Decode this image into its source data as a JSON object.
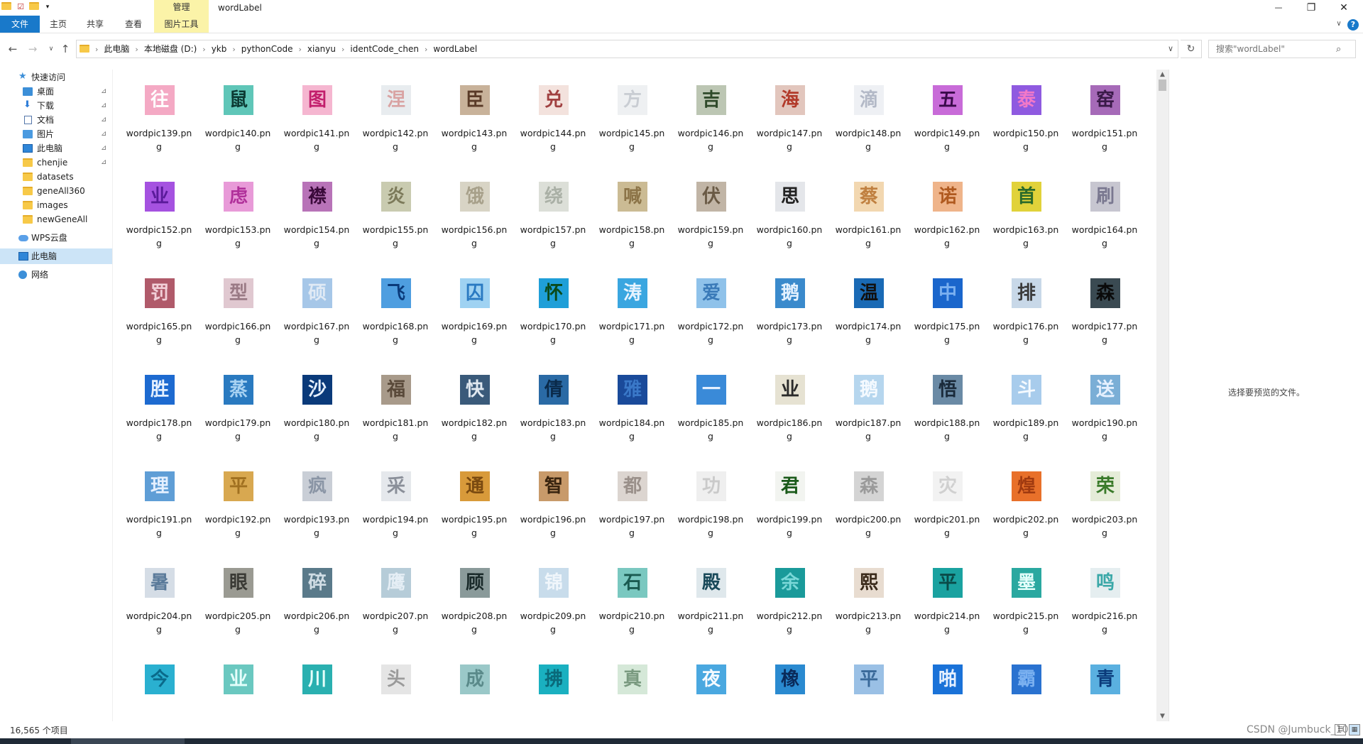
{
  "window": {
    "title": "wordLabel",
    "manage_tab": "管理",
    "min_icon": "—",
    "max_icon": "❐",
    "close_icon": "✕"
  },
  "ribbon": {
    "tabs": [
      "文件",
      "主页",
      "共享",
      "查看",
      "图片工具"
    ],
    "collapse_icon": "∨",
    "help_icon": "?"
  },
  "nav": {
    "back": "←",
    "forward": "→",
    "recent": "∨",
    "up": "↑"
  },
  "address": {
    "crumbs": [
      "此电脑",
      "本地磁盘 (D:)",
      "ykb",
      "pythonCode",
      "xianyu",
      "identCode_chen",
      "wordLabel"
    ],
    "separator": "›",
    "dropdown": "∨",
    "refresh": "↻"
  },
  "search": {
    "placeholder": "搜索\"wordLabel\"",
    "icon": "⌕"
  },
  "sidebar": {
    "items": [
      {
        "label": "快速访问",
        "icon": "star-icon",
        "pinned": false
      },
      {
        "label": "桌面",
        "icon": "desktop-icon",
        "pinned": true
      },
      {
        "label": "下载",
        "icon": "download-icon",
        "pinned": true
      },
      {
        "label": "文档",
        "icon": "document-icon",
        "pinned": true
      },
      {
        "label": "图片",
        "icon": "pictures-icon",
        "pinned": true
      },
      {
        "label": "此电脑",
        "icon": "computer-icon",
        "pinned": true
      },
      {
        "label": "chenjie",
        "icon": "folder-icon",
        "pinned": true
      },
      {
        "label": "datasets",
        "icon": "folder-icon",
        "pinned": false
      },
      {
        "label": "geneAll360",
        "icon": "folder-icon",
        "pinned": false
      },
      {
        "label": "images",
        "icon": "folder-icon",
        "pinned": false
      },
      {
        "label": "newGeneAll",
        "icon": "folder-icon",
        "pinned": false
      },
      {
        "label": "WPS云盘",
        "icon": "cloud-icon",
        "pinned": false
      },
      {
        "label": "此电脑",
        "icon": "computer-icon",
        "pinned": false,
        "selected": true
      },
      {
        "label": "网络",
        "icon": "network-icon",
        "pinned": false
      }
    ],
    "pin_glyph": "📌"
  },
  "files": [
    {
      "name": "wordpic139.png",
      "glyph": "往",
      "bg": "#f4a9c4",
      "fg": "#ffffff"
    },
    {
      "name": "wordpic140.png",
      "glyph": "鼠",
      "bg": "#5fc6b8",
      "fg": "#0c3a33"
    },
    {
      "name": "wordpic141.png",
      "glyph": "图",
      "bg": "#f5b6d0",
      "fg": "#c21e6c"
    },
    {
      "name": "wordpic142.png",
      "glyph": "涅",
      "bg": "#e8ecef",
      "fg": "#d9a3a3"
    },
    {
      "name": "wordpic143.png",
      "glyph": "臣",
      "bg": "#c8b29a",
      "fg": "#5a3b28"
    },
    {
      "name": "wordpic144.png",
      "glyph": "兑",
      "bg": "#f3e2dd",
      "fg": "#a04040"
    },
    {
      "name": "wordpic145.png",
      "glyph": "方",
      "bg": "#eef0f2",
      "fg": "#c9cdd3"
    },
    {
      "name": "wordpic146.png",
      "glyph": "吉",
      "bg": "#bcc6b3",
      "fg": "#2f4a2a"
    },
    {
      "name": "wordpic147.png",
      "glyph": "海",
      "bg": "#e2c6bd",
      "fg": "#b23a2a"
    },
    {
      "name": "wordpic148.png",
      "glyph": "滴",
      "bg": "#eef0f4",
      "fg": "#b3b9c7"
    },
    {
      "name": "wordpic149.png",
      "glyph": "五",
      "bg": "#c86bd8",
      "fg": "#3a0a4a"
    },
    {
      "name": "wordpic150.png",
      "glyph": "泰",
      "bg": "#8f5ae0",
      "fg": "#f279c8"
    },
    {
      "name": "wordpic151.png",
      "glyph": "窑",
      "bg": "#a66ab8",
      "fg": "#3a1a48"
    },
    {
      "name": "wordpic152.png",
      "glyph": "业",
      "bg": "#a552e0",
      "fg": "#5a1a9a"
    },
    {
      "name": "wordpic153.png",
      "glyph": "虑",
      "bg": "#e89ad8",
      "fg": "#b0309a"
    },
    {
      "name": "wordpic154.png",
      "glyph": "襟",
      "bg": "#b873b8",
      "fg": "#3a0a3a"
    },
    {
      "name": "wordpic155.png",
      "glyph": "炎",
      "bg": "#c9cbb0",
      "fg": "#7c7a5a"
    },
    {
      "name": "wordpic156.png",
      "glyph": "饿",
      "bg": "#d8d4c5",
      "fg": "#a7a08a"
    },
    {
      "name": "wordpic157.png",
      "glyph": "绕",
      "bg": "#dcdfd8",
      "fg": "#aab0a6"
    },
    {
      "name": "wordpic158.png",
      "glyph": "喊",
      "bg": "#cbbb94",
      "fg": "#8c7448"
    },
    {
      "name": "wordpic159.png",
      "glyph": "伏",
      "bg": "#c1b5a6",
      "fg": "#6a5a45"
    },
    {
      "name": "wordpic160.png",
      "glyph": "思",
      "bg": "#e4e6ea",
      "fg": "#222222"
    },
    {
      "name": "wordpic161.png",
      "glyph": "蔡",
      "bg": "#f2d7b0",
      "fg": "#c08040"
    },
    {
      "name": "wordpic162.png",
      "glyph": "诺",
      "bg": "#efb48a",
      "fg": "#b05a20"
    },
    {
      "name": "wordpic163.png",
      "glyph": "首",
      "bg": "#e1d23a",
      "fg": "#2a6a2a"
    },
    {
      "name": "wordpic164.png",
      "glyph": "刷",
      "bg": "#c7c6d0",
      "fg": "#7a7890"
    },
    {
      "name": "wordpic165.png",
      "glyph": "罚",
      "bg": "#b05a6a",
      "fg": "#f2d0d8"
    },
    {
      "name": "wordpic166.png",
      "glyph": "型",
      "bg": "#e0c8d0",
      "fg": "#9a7a85"
    },
    {
      "name": "wordpic167.png",
      "glyph": "硕",
      "bg": "#a6c7e8",
      "fg": "#e0eaf5"
    },
    {
      "name": "wordpic168.png",
      "glyph": "飞",
      "bg": "#4e9ee0",
      "fg": "#0a3a7a"
    },
    {
      "name": "wordpic169.png",
      "glyph": "囚",
      "bg": "#9fd2f2",
      "fg": "#2a7ac2"
    },
    {
      "name": "wordpic170.png",
      "glyph": "怀",
      "bg": "#1f9fd8",
      "fg": "#0a4a1a"
    },
    {
      "name": "wordpic171.png",
      "glyph": "涛",
      "bg": "#3aa6e0",
      "fg": "#e8f4ff"
    },
    {
      "name": "wordpic172.png",
      "glyph": "爱",
      "bg": "#8fc2ea",
      "fg": "#3a7ab8"
    },
    {
      "name": "wordpic173.png",
      "glyph": "鹅",
      "bg": "#3a8acc",
      "fg": "#e5f2ff"
    },
    {
      "name": "wordpic174.png",
      "glyph": "温",
      "bg": "#1a6ab5",
      "fg": "#111111"
    },
    {
      "name": "wordpic175.png",
      "glyph": "中",
      "bg": "#1a66cc",
      "fg": "#7ab0f0"
    },
    {
      "name": "wordpic176.png",
      "glyph": "排",
      "bg": "#c8d8e8",
      "fg": "#3a3a3a"
    },
    {
      "name": "wordpic177.png",
      "glyph": "森",
      "bg": "#3a4a52",
      "fg": "#0a0a0a"
    },
    {
      "name": "wordpic178.png",
      "glyph": "胜",
      "bg": "#1d6ad0",
      "fg": "#e5f0ff"
    },
    {
      "name": "wordpic179.png",
      "glyph": "蒸",
      "bg": "#2a7ac0",
      "fg": "#a8d2f2"
    },
    {
      "name": "wordpic180.png",
      "glyph": "沙",
      "bg": "#0a3a7a",
      "fg": "#e5f0ff"
    },
    {
      "name": "wordpic181.png",
      "glyph": "福",
      "bg": "#a89a8a",
      "fg": "#5a4a3a"
    },
    {
      "name": "wordpic182.png",
      "glyph": "快",
      "bg": "#3a5a7a",
      "fg": "#e0e8f0"
    },
    {
      "name": "wordpic183.png",
      "glyph": "倩",
      "bg": "#2a6aa5",
      "fg": "#0a2a4a"
    },
    {
      "name": "wordpic184.png",
      "glyph": "雅",
      "bg": "#1a4a9a",
      "fg": "#3a78c8"
    },
    {
      "name": "wordpic185.png",
      "glyph": "一",
      "bg": "#3a8ad8",
      "fg": "#e5f0ff"
    },
    {
      "name": "wordpic186.png",
      "glyph": "业",
      "bg": "#e6e2d2",
      "fg": "#2a2a2a"
    },
    {
      "name": "wordpic187.png",
      "glyph": "鹅",
      "bg": "#b6d6ee",
      "fg": "#f5faff"
    },
    {
      "name": "wordpic188.png",
      "glyph": "悟",
      "bg": "#6a8aa5",
      "fg": "#1a2a3a"
    },
    {
      "name": "wordpic189.png",
      "glyph": "斗",
      "bg": "#a8ccec",
      "fg": "#f5faff"
    },
    {
      "name": "wordpic190.png",
      "glyph": "送",
      "bg": "#7aaed6",
      "fg": "#e5f0ff"
    },
    {
      "name": "wordpic191.png",
      "glyph": "理",
      "bg": "#5f9ed6",
      "fg": "#e5f0ff"
    },
    {
      "name": "wordpic192.png",
      "glyph": "平",
      "bg": "#d8a850",
      "fg": "#a07020"
    },
    {
      "name": "wordpic193.png",
      "glyph": "疯",
      "bg": "#c9ced6",
      "fg": "#8a95a5"
    },
    {
      "name": "wordpic194.png",
      "glyph": "采",
      "bg": "#e5e8ec",
      "fg": "#8a8f99"
    },
    {
      "name": "wordpic195.png",
      "glyph": "通",
      "bg": "#d89a3a",
      "fg": "#7a4a10"
    },
    {
      "name": "wordpic196.png",
      "glyph": "智",
      "bg": "#c89a6a",
      "fg": "#3a2510"
    },
    {
      "name": "wordpic197.png",
      "glyph": "都",
      "bg": "#dcd5d0",
      "fg": "#9a908a"
    },
    {
      "name": "wordpic198.png",
      "glyph": "功",
      "bg": "#efefef",
      "fg": "#cacaca"
    },
    {
      "name": "wordpic199.png",
      "glyph": "君",
      "bg": "#f2f4f0",
      "fg": "#1a5a1a"
    },
    {
      "name": "wordpic200.png",
      "glyph": "森",
      "bg": "#d4d4d4",
      "fg": "#9a9a9a"
    },
    {
      "name": "wordpic201.png",
      "glyph": "灾",
      "bg": "#f2f2f2",
      "fg": "#d0d0d0"
    },
    {
      "name": "wordpic202.png",
      "glyph": "煌",
      "bg": "#e8702a",
      "fg": "#a03a10"
    },
    {
      "name": "wordpic203.png",
      "glyph": "荣",
      "bg": "#e5ecd8",
      "fg": "#3a7a2a"
    },
    {
      "name": "wordpic204.png",
      "glyph": "暑",
      "bg": "#d5dde6",
      "fg": "#5a7a9a"
    },
    {
      "name": "wordpic205.png",
      "glyph": "眼",
      "bg": "#9a9a92",
      "fg": "#3a3a35"
    },
    {
      "name": "wordpic206.png",
      "glyph": "碎",
      "bg": "#5a7a8a",
      "fg": "#d0dde5"
    },
    {
      "name": "wordpic207.png",
      "glyph": "鹰",
      "bg": "#b6ccd8",
      "fg": "#e5eef5"
    },
    {
      "name": "wordpic208.png",
      "glyph": "顾",
      "bg": "#8a9a9a",
      "fg": "#1a2a2a"
    },
    {
      "name": "wordpic209.png",
      "glyph": "锦",
      "bg": "#c8dceb",
      "fg": "#f0f6fb"
    },
    {
      "name": "wordpic210.png",
      "glyph": "石",
      "bg": "#7ac8c0",
      "fg": "#1a5a50"
    },
    {
      "name": "wordpic211.png",
      "glyph": "殿",
      "bg": "#dfe8ec",
      "fg": "#1a4a5a"
    },
    {
      "name": "wordpic212.png",
      "glyph": "余",
      "bg": "#1a9a9a",
      "fg": "#7ad8d8"
    },
    {
      "name": "wordpic213.png",
      "glyph": "熙",
      "bg": "#e8dcd0",
      "fg": "#3a2a1a"
    },
    {
      "name": "wordpic214.png",
      "glyph": "平",
      "bg": "#1aa2a0",
      "fg": "#0a4a48"
    },
    {
      "name": "wordpic215.png",
      "glyph": "墨",
      "bg": "#2aa8a0",
      "fg": "#e5fffb"
    },
    {
      "name": "wordpic216.png",
      "glyph": "鸣",
      "bg": "#e5eef0",
      "fg": "#3aa8a8"
    },
    {
      "name": "",
      "glyph": "今",
      "bg": "#2ab0d0",
      "fg": "#0a6a8a"
    },
    {
      "name": "",
      "glyph": "业",
      "bg": "#6ac8c0",
      "fg": "#e5fffb"
    },
    {
      "name": "",
      "glyph": "川",
      "bg": "#2ab0b0",
      "fg": "#e5fffb"
    },
    {
      "name": "",
      "glyph": "头",
      "bg": "#e5e5e5",
      "fg": "#9a9a9a"
    },
    {
      "name": "",
      "glyph": "成",
      "bg": "#9ac8c8",
      "fg": "#5a8a8a"
    },
    {
      "name": "",
      "glyph": "拂",
      "bg": "#1ab0c0",
      "fg": "#0a6a7a"
    },
    {
      "name": "",
      "glyph": "真",
      "bg": "#d5e8d8",
      "fg": "#7a9a80"
    },
    {
      "name": "",
      "glyph": "夜",
      "bg": "#4aa8e0",
      "fg": "#f5faff"
    },
    {
      "name": "",
      "glyph": "橡",
      "bg": "#2a8ad0",
      "fg": "#0a2a5a"
    },
    {
      "name": "",
      "glyph": "平",
      "bg": "#9ac0e5",
      "fg": "#3a6a9a"
    },
    {
      "name": "",
      "glyph": "啪",
      "bg": "#1a72d8",
      "fg": "#e5f0ff"
    },
    {
      "name": "",
      "glyph": "霸",
      "bg": "#2a72d0",
      "fg": "#7ab0f0"
    },
    {
      "name": "",
      "glyph": "青",
      "bg": "#5ab0e0",
      "fg": "#0a3a7a"
    }
  ],
  "preview": {
    "empty_text": "选择要预览的文件。"
  },
  "status": {
    "count": "16,565 个项目",
    "watermark": "CSDN @Jumbuck_10"
  }
}
